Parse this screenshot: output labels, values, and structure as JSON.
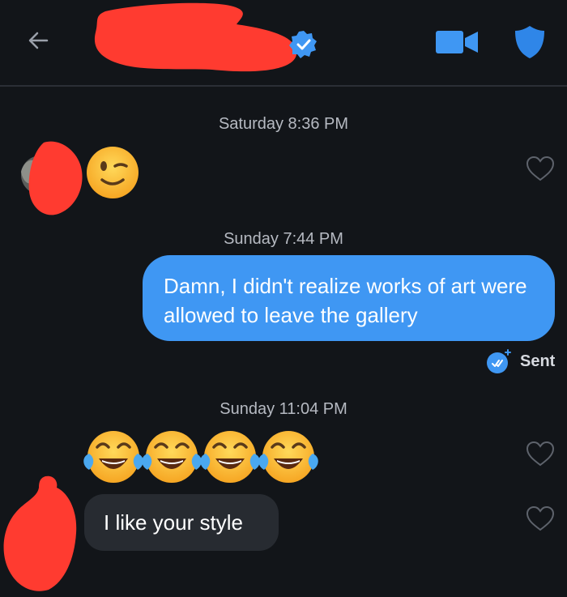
{
  "header": {
    "back_icon": "arrow-left-icon",
    "verified_icon": "verified-badge-icon",
    "video_icon": "video-camera-icon",
    "shield_icon": "shield-icon",
    "accent_color": "#2f86e8"
  },
  "conversation": {
    "groups": [
      {
        "timestamp": "Saturday 8:36 PM",
        "incoming_emoji": "winking-face-emoji"
      },
      {
        "timestamp": "Sunday 7:44 PM",
        "outgoing_text": "Damn, I didn't realize works of art were allowed to leave the gallery",
        "status": "Sent",
        "status_icon": "double-check-icon"
      },
      {
        "timestamp": "Sunday 11:04 PM",
        "incoming_emoji": "face-with-tears-of-joy-emoji x4",
        "incoming_text": "I like your style"
      }
    ],
    "colors": {
      "background": "#121519",
      "outgoing_bubble": "#3f97f3",
      "incoming_bubble": "#272b31",
      "redaction": "#ff3b30"
    }
  }
}
